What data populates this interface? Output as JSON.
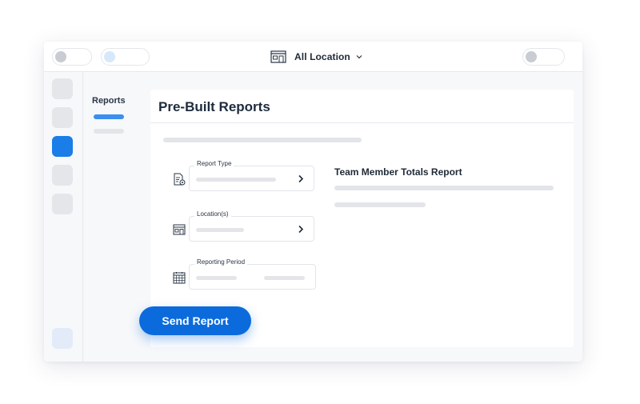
{
  "topbar": {
    "location_selector": {
      "label": "All Location",
      "icon": "store-icon",
      "dropdown_icon": "chevron-down-icon"
    },
    "toggles": [
      {
        "name": "toggle-left",
        "dot_color": "#c9ccd2"
      },
      {
        "name": "toggle-left-2",
        "dot_color": "#d7e8fb"
      },
      {
        "name": "toggle-right",
        "dot_color": "#c9ccd2"
      }
    ]
  },
  "leftnav": {
    "active_index": 2,
    "accent": "#1a7de8"
  },
  "subnav": {
    "title": "Reports"
  },
  "main": {
    "title": "Pre-Built Reports",
    "fields": [
      {
        "label": "Report Type",
        "icon": "report-document-icon",
        "action_icon": "chevron-right-icon"
      },
      {
        "label": "Location(s)",
        "icon": "store-icon",
        "action_icon": "chevron-right-icon"
      },
      {
        "label": "Reporting Period",
        "icon": "calendar-icon"
      }
    ],
    "report_preview": {
      "title": "Team Member Totals Report"
    },
    "send_button_label": "Send Report"
  },
  "colors": {
    "primary": "#0b6bdc",
    "text": "#1f2a37",
    "placeholder": "#e3e5e9"
  }
}
